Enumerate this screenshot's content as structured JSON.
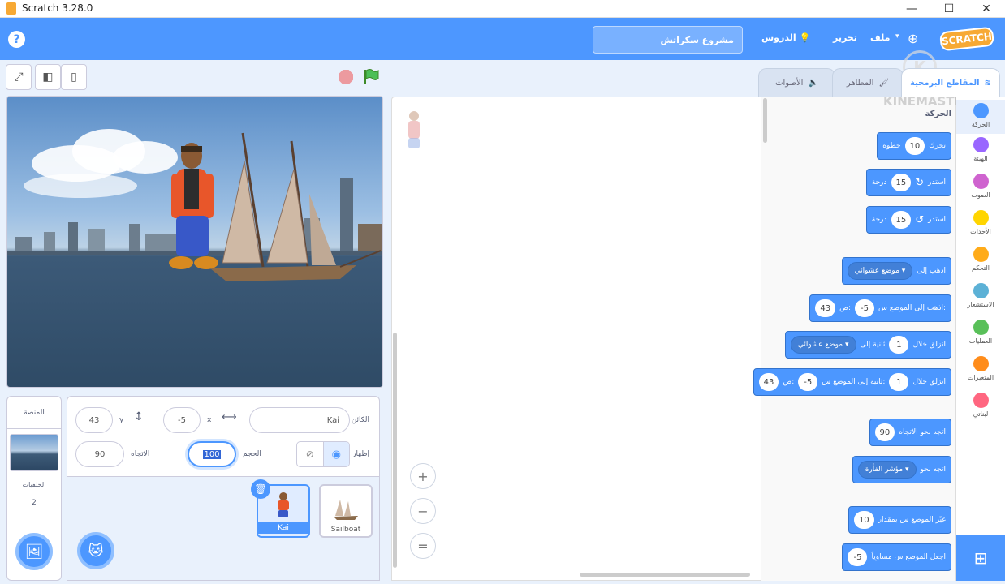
{
  "window": {
    "title": "Scratch 3.28.0",
    "minimize": "—",
    "maximize": "☐",
    "close": "✕"
  },
  "menu": {
    "help": "?",
    "project_name": "مشروع سكراتش",
    "tutorials": "الدروس",
    "edit": "تحرير",
    "file": "ملف",
    "logo": "SCRATCH"
  },
  "tabs": {
    "code": "المقاطع البرمجية",
    "costumes": "المظاهر",
    "sounds": "الأصوات"
  },
  "categories": [
    {
      "label": "الحركة",
      "color": "#4c97ff"
    },
    {
      "label": "الهيئة",
      "color": "#9966ff"
    },
    {
      "label": "الصوت",
      "color": "#cf63cf"
    },
    {
      "label": "الأحداث",
      "color": "#ffd500"
    },
    {
      "label": "التحكم",
      "color": "#ffab19"
    },
    {
      "label": "الاستشعار",
      "color": "#5cb1d6"
    },
    {
      "label": "العمليات",
      "color": "#59c059"
    },
    {
      "label": "المتغيرات",
      "color": "#ff8c1a"
    },
    {
      "label": "لبناتي",
      "color": "#ff6680"
    }
  ],
  "palette": {
    "section": "الحركة",
    "blocks": [
      {
        "text": "تحرك",
        "val": "10",
        "after": "خطوة"
      },
      {
        "text": "استدر",
        "icon": "↻",
        "val": "15",
        "after": "درجة"
      },
      {
        "text": "استدر",
        "icon": "↺",
        "val": "15",
        "after": "درجة"
      },
      {
        "text": "اذهب إلى",
        "dd": "موضع عشوائي ▾"
      },
      {
        "text": "اذهب إلى الموضع س:",
        "val": "-5",
        "mid": "ص:",
        "val2": "43"
      },
      {
        "text": "انزلق خلال",
        "val": "1",
        "mid": "ثانية إلى",
        "dd": "موضع عشوائي ▾"
      },
      {
        "text": "انزلق خلال",
        "val": "1",
        "mid": "ثانية إلى الموضع س:",
        "val2": "-5",
        "mid2": "ص:",
        "val3": "43"
      },
      {
        "text": "اتجه نحو الاتجاه",
        "val": "90"
      },
      {
        "text": "اتجه نحو",
        "dd": "مؤشر الفأرة ▾"
      },
      {
        "text": "غيّر الموضع س بمقدار",
        "val": "10"
      },
      {
        "text": "اجعل الموضع س مساوياً",
        "val": "-5"
      }
    ]
  },
  "sprite_info": {
    "sprite_label": "الكائن",
    "sprite_name": "Kai",
    "x_label": "x",
    "x_value": "-5",
    "y_label": "y",
    "y_value": "43",
    "show_label": "إظهار",
    "size_label": "الحجم",
    "size_value": "100",
    "direction_label": "الاتجاه",
    "direction_value": "90"
  },
  "sprites": [
    {
      "name": "Kai",
      "selected": true
    },
    {
      "name": "Sailboat",
      "selected": false
    }
  ],
  "stage_panel": {
    "title": "المنصة",
    "backdrops_label": "الخلفيات",
    "backdrops_count": "2"
  },
  "watermark": {
    "text": "KINEMASTER",
    "k": "K"
  },
  "zoom": {
    "in": "+",
    "out": "−",
    "reset": "="
  }
}
